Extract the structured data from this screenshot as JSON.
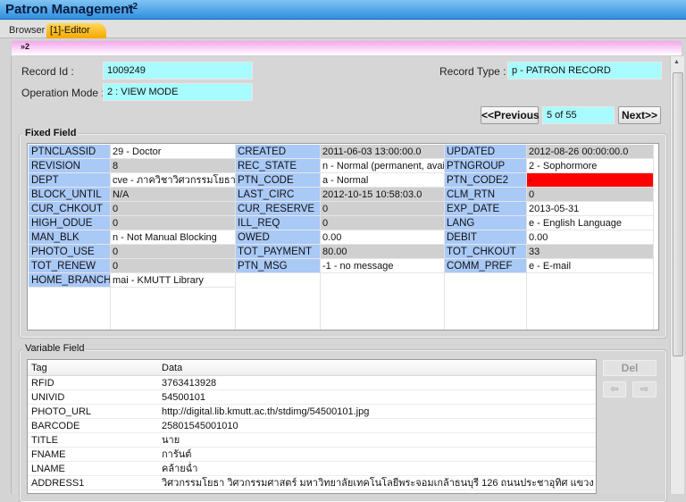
{
  "window": {
    "title": "Patron Management",
    "title_suffix": "»2"
  },
  "tabs": [
    {
      "label": "Browser"
    },
    {
      "label": "[1]-Editor"
    }
  ],
  "header_marker": "»2",
  "record": {
    "record_id_label": "Record Id :",
    "record_id": "1009249",
    "operation_mode_label": "Operation Mode :",
    "operation_mode": "2 : VIEW MODE",
    "record_type_label": "Record Type :",
    "record_type": "p - PATRON RECORD"
  },
  "pager": {
    "previous_label": "<<Previous",
    "position": "5 of 55",
    "next_label": "Next>>"
  },
  "fixed_field": {
    "title": "Fixed Field",
    "rows": [
      [
        [
          "PTNCLASSID",
          "29 - Doctor"
        ],
        [
          "CREATED",
          "2011-06-03 13:00:00.0"
        ],
        [
          "UPDATED",
          "2012-08-26 00:00:00.0"
        ]
      ],
      [
        [
          "REVISION",
          "8"
        ],
        [
          "REC_STATE",
          "n - Normal (permanent, avail"
        ],
        [
          "PTNGROUP",
          "2 - Sophormore"
        ]
      ],
      [
        [
          "DEPT",
          "cve - ภาควิชาวิศวกรรมโยธา"
        ],
        [
          "PTN_CODE",
          "a - Normal"
        ],
        [
          "PTN_CODE2",
          "-"
        ]
      ],
      [
        [
          "BLOCK_UNTIL",
          "N/A"
        ],
        [
          "LAST_CIRC",
          "2012-10-15 10:58:03.0"
        ],
        [
          "CLM_RTN",
          "0"
        ]
      ],
      [
        [
          "CUR_CHKOUT",
          "0"
        ],
        [
          "CUR_RESERVE",
          "0"
        ],
        [
          "EXP_DATE",
          "2013-05-31"
        ]
      ],
      [
        [
          "HIGH_ODUE",
          "0"
        ],
        [
          "ILL_REQ",
          "0"
        ],
        [
          "LANG",
          "e - English Language"
        ]
      ],
      [
        [
          "MAN_BLK",
          "n - Not Manual Blocking"
        ],
        [
          "OWED",
          "0.00"
        ],
        [
          "DEBIT",
          "0.00"
        ]
      ],
      [
        [
          "PHOTO_USE",
          "0"
        ],
        [
          "TOT_PAYMENT",
          "80.00"
        ],
        [
          "TOT_CHKOUT",
          "33"
        ]
      ],
      [
        [
          "TOT_RENEW",
          "0"
        ],
        [
          "PTN_MSG",
          "-1 - no message"
        ],
        [
          "COMM_PREF",
          "e - E-mail"
        ]
      ],
      [
        [
          "HOME_BRANCH",
          "mai - KMUTT Library"
        ]
      ]
    ],
    "highlight_color": "#ff0000"
  },
  "variable_field": {
    "title": "Variable Field",
    "columns": [
      "Tag",
      "Data"
    ],
    "rows": [
      [
        "RFID",
        "3763413928"
      ],
      [
        "UNIVID",
        "54500101"
      ],
      [
        "PHOTO_URL",
        "http://digital.lib.kmutt.ac.th/stdimg/54500101.jpg"
      ],
      [
        "BARCODE",
        "25801545001010"
      ],
      [
        "TITLE",
        "นาย"
      ],
      [
        "FNAME",
        "การันต์"
      ],
      [
        "LNAME",
        "คล้ายฉ่ำ"
      ],
      [
        "ADDRESS1",
        "วิศวกรรมโยธา วิศวกรรมศาสตร์ มหาวิทยาลัยเทคโนโลยีพระจอมเกล้าธนบุรี 126 ถนนประชาอุทิศ แขวงบางมด เขตทุ่งครุ กรุงเ..."
      ]
    ],
    "del_label": "Del"
  }
}
